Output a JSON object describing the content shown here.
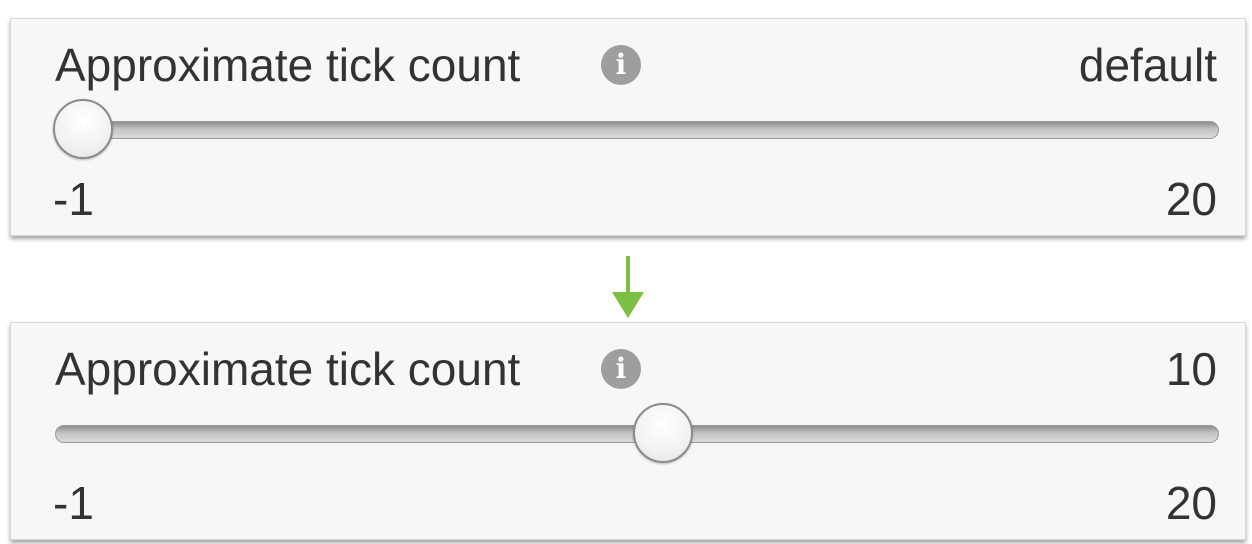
{
  "panels": [
    {
      "label": "Approximate tick count",
      "value_text": "default",
      "min_label": "-1",
      "max_label": "20",
      "min": -1,
      "max": 20,
      "value": -1
    },
    {
      "label": "Approximate tick count",
      "value_text": "10",
      "min_label": "-1",
      "max_label": "20",
      "min": -1,
      "max": 20,
      "value": 10
    }
  ],
  "icons": {
    "info": "info-icon",
    "arrow": "arrow-down-icon"
  },
  "colors": {
    "arrow": "#7bc043",
    "info_icon_bg": "#9e9e9e",
    "text": "#333333"
  }
}
